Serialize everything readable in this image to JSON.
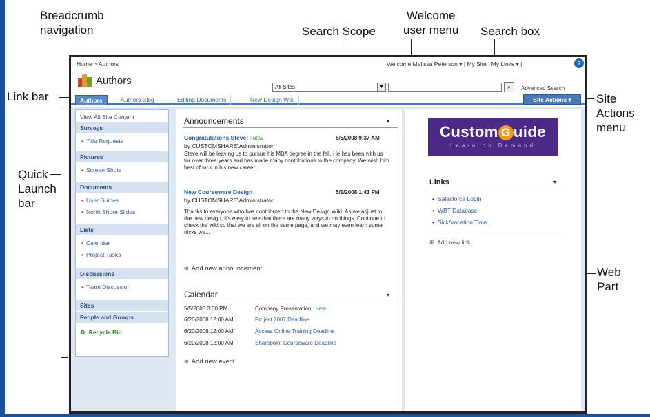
{
  "callouts": {
    "breadcrumb": [
      "Breadcrumb",
      "navigation"
    ],
    "welcome": [
      "Welcome",
      "user menu"
    ],
    "search_scope": "Search Scope",
    "search_box": "Search box",
    "link_bar": "Link bar",
    "site_actions": [
      "Site",
      "Actions",
      "menu"
    ],
    "quick_launch": [
      "Quick",
      "Launch",
      "bar"
    ],
    "web_part": [
      "Web",
      "Part"
    ]
  },
  "topbar": {
    "breadcrumb": "Home > Authors",
    "welcome": "Welcome Melissa Peterson ▾  |  My Site  |  My Links ▾  |",
    "help": "?"
  },
  "header": {
    "site_title": "Authors",
    "search_scope": "All Sites",
    "search_go": "⌕",
    "advanced_search": "Advanced Search"
  },
  "linkbar": {
    "tabs": [
      "Authors",
      "Authors Blog",
      "Editing Documents",
      "New Design Wiki"
    ],
    "site_actions": "Site Actions ▾"
  },
  "quick_launch": {
    "view_all": "View All Site Content",
    "surveys": "Surveys",
    "surveys_items": [
      "Title Requests"
    ],
    "pictures": "Pictures",
    "pictures_items": [
      "Screen Shots"
    ],
    "documents": "Documents",
    "documents_items": [
      "User Guides",
      "North Shore Slides"
    ],
    "lists": "Lists",
    "lists_items": [
      "Calendar",
      "Project Tasks"
    ],
    "discussions": "Discussions",
    "discussions_items": [
      "Team Discussion"
    ],
    "sites": "Sites",
    "people": "People and Groups",
    "recycle": "Recycle Bin"
  },
  "announcements": {
    "title": "Announcements",
    "menu": "▾",
    "items": [
      {
        "title": "Congratulations Steve!",
        "badge": "! NEW",
        "date": "5/5/2008 9:37 AM",
        "by": "by CUSTOMSHARE\\Administrator",
        "body": "Steve will be leaving us to pursue his MBA degree in the fall. He has been with us for over three years and has made many contributions to the company. We wish him best of luck in his new career!"
      },
      {
        "title": "New Courseware Design",
        "date": "5/1/2008 1:41 PM",
        "by": "by CUSTOMSHARE\\Administrator",
        "body": "Thanks to everyone who has contributed to the New Design Wiki. As we adjust to the new design, it's easy to see that there are many ways to do things. Continue to check the wiki so that we are all on the same page, and we may even learn some tricks we..."
      }
    ],
    "add": "Add new announcement"
  },
  "calendar": {
    "title": "Calendar",
    "menu": "▾",
    "rows": [
      {
        "date": "5/5/2008 3:00 PM",
        "title": "Company Presentation",
        "badge": "! NEW"
      },
      {
        "date": "6/20/2008 12:00 AM",
        "title": "Project 2007 Deadline"
      },
      {
        "date": "6/20/2008 12:00 AM",
        "title": "Access Online Training Deadline"
      },
      {
        "date": "6/20/2008 12:00 AM",
        "title": "Sharepoint Courseware Deadline"
      }
    ],
    "add": "Add new event"
  },
  "logo": {
    "name_pre": "Custom",
    "name_g": "G",
    "name_post": "uide",
    "tagline": "Learn on Demand"
  },
  "links": {
    "title": "Links",
    "menu": "▾",
    "items": [
      "Salesforce Login",
      "WBT Database",
      "Sick/Vacation Time"
    ],
    "add": "Add new link"
  }
}
